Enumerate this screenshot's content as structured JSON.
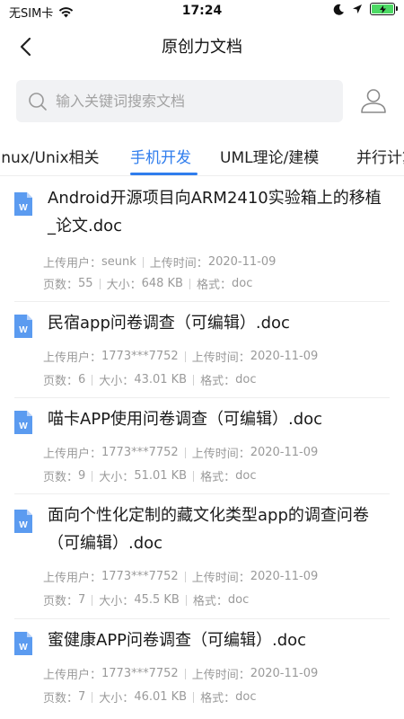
{
  "status_bar": {
    "carrier": "无SIM卡",
    "time": "17:24"
  },
  "nav": {
    "title": "原创力文档"
  },
  "search": {
    "placeholder": "输入关键词搜索文档"
  },
  "tabs": [
    {
      "label": "Linux/Unix相关"
    },
    {
      "label": "手机开发"
    },
    {
      "label": "UML理论/建模"
    },
    {
      "label": "并行计算"
    }
  ],
  "active_tab": 1,
  "documents": [
    {
      "title": "Android开源项目向ARM2410实验箱上的移植_论文.doc",
      "uploader_label": "上传用户：",
      "uploader": "seunk",
      "time_label": "上传时间：",
      "time": "2020-11-09",
      "pages_label": "页数：",
      "pages": "55",
      "size_label": "大小：",
      "size": "648 KB",
      "format_label": "格式：",
      "format": "doc"
    },
    {
      "title": "民宿app问卷调查（可编辑）.doc",
      "uploader_label": "上传用户：",
      "uploader": "1773***7752",
      "time_label": "上传时间：",
      "time": "2020-11-09",
      "pages_label": "页数：",
      "pages": "6",
      "size_label": "大小：",
      "size": "43.01 KB",
      "format_label": "格式：",
      "format": "doc"
    },
    {
      "title": "喵卡APP使用问卷调查（可编辑）.doc",
      "uploader_label": "上传用户：",
      "uploader": "1773***7752",
      "time_label": "上传时间：",
      "time": "2020-11-09",
      "pages_label": "页数：",
      "pages": "9",
      "size_label": "大小：",
      "size": "51.01 KB",
      "format_label": "格式：",
      "format": "doc"
    },
    {
      "title": "面向个性化定制的藏文化类型app的调查问卷（可编辑）.doc",
      "uploader_label": "上传用户：",
      "uploader": "1773***7752",
      "time_label": "上传时间：",
      "time": "2020-11-09",
      "pages_label": "页数：",
      "pages": "7",
      "size_label": "大小：",
      "size": "45.5 KB",
      "format_label": "格式：",
      "format": "doc"
    },
    {
      "title": "蜜健康APP问卷调查（可编辑）.doc",
      "uploader_label": "上传用户：",
      "uploader": "1773***7752",
      "time_label": "上传时间：",
      "time": "2020-11-09",
      "pages_label": "页数：",
      "pages": "7",
      "size_label": "大小：",
      "size": "46.01 KB",
      "format_label": "格式：",
      "format": "doc"
    }
  ],
  "colors": {
    "accent": "#2f7ded",
    "doc_icon": "#5b9bf0",
    "meta_text": "#9a9a9a"
  },
  "icons": {
    "back": "chevron-left-icon",
    "search": "search-icon",
    "user": "user-icon",
    "doc": "word-doc-icon"
  }
}
